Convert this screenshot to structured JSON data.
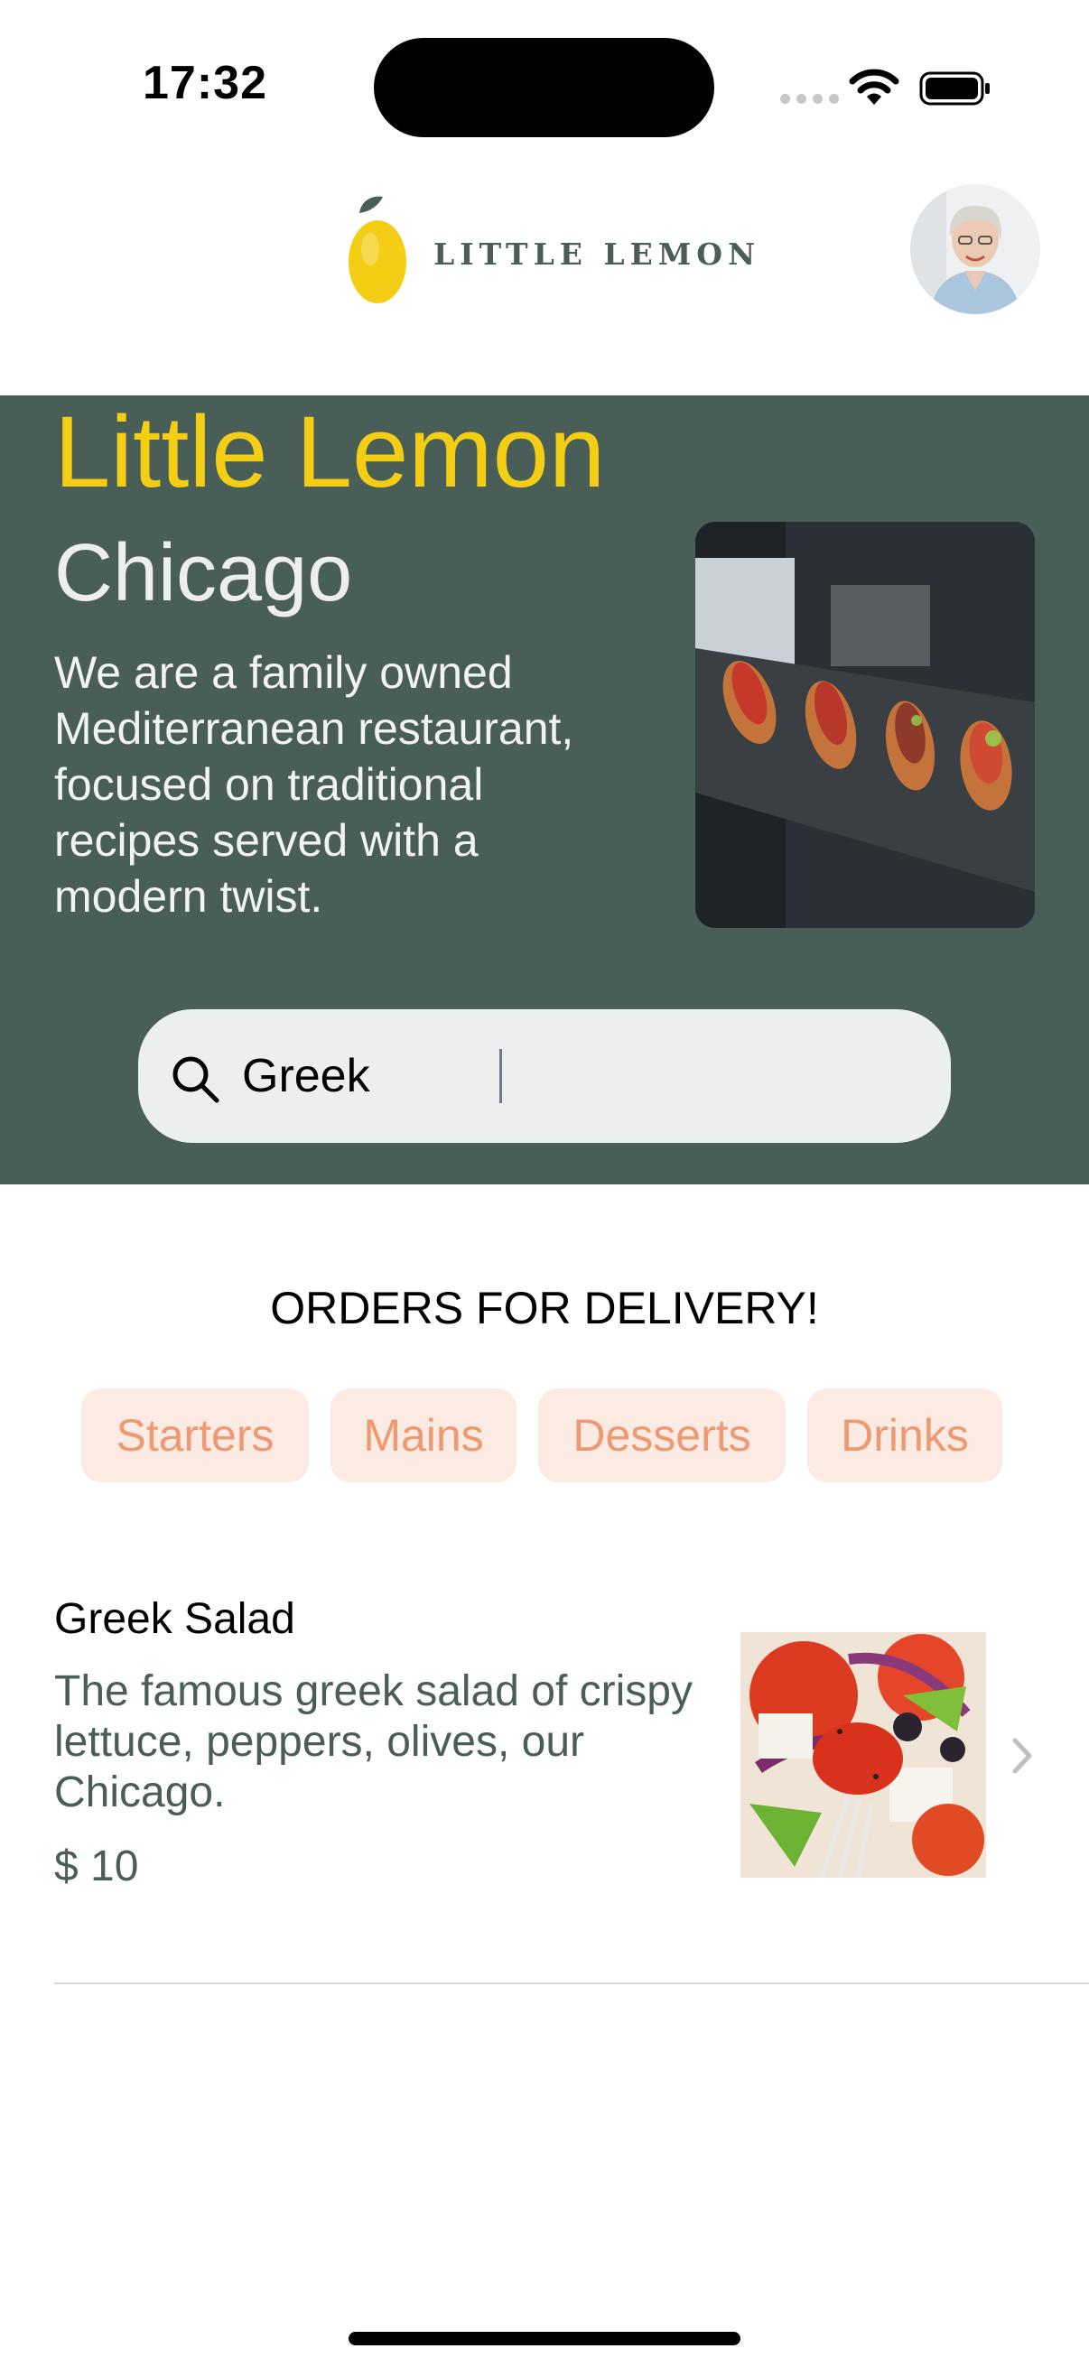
{
  "status_bar": {
    "time": "17:32",
    "icons": [
      "cellular-icon",
      "wifi-icon",
      "battery-icon"
    ]
  },
  "header": {
    "logo_text": "LITTLE LEMON",
    "avatar_icon": "profile-avatar"
  },
  "hero": {
    "title": "Little Lemon",
    "subtitle": "Chicago",
    "description": "We are a family owned\n Mediterranean restaurant,\n focused on traditional\n recipes served with a\n modern twist.",
    "image_icon": "bruschetta-photo",
    "search": {
      "value": "Greek",
      "icon": "search-icon"
    }
  },
  "orders": {
    "title": "ORDERS FOR DELIVERY!",
    "categories": [
      "Starters",
      "Mains",
      "Desserts",
      "Drinks"
    ]
  },
  "menu": {
    "items": [
      {
        "name": "Greek Salad",
        "description": "The famous greek salad of crispy lettuce, peppers, olives, our Chicago.",
        "price": "$ 10",
        "image_icon": "greek-salad-photo",
        "chevron_icon": "chevron-right-icon"
      }
    ]
  },
  "colors": {
    "primary_green": "#495e57",
    "primary_yellow": "#f4ce14",
    "chip_bg": "#fbebe3",
    "chip_text": "#ee9972",
    "search_bg": "#edefee"
  }
}
